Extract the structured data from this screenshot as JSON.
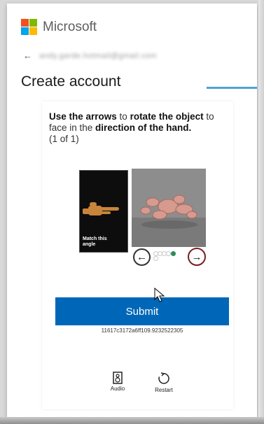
{
  "header": {
    "brand": "Microsoft",
    "back_arrow": "←",
    "email": "andy.garde.hotmail@gmail.com",
    "title": "Create account"
  },
  "challenge": {
    "instruction_prefix": "Use the arrows",
    "instruction_mid1": " to ",
    "instruction_rotate": "rotate the object",
    "instruction_mid2": " to face in the ",
    "instruction_direction": "direction of the hand.",
    "instruction_count": "(1 of 1)",
    "reference_label": "Match this angle",
    "left_arrow": "←",
    "right_arrow": "→",
    "submit_label": "Submit",
    "token": "11617c3172a6ff109.9232522305",
    "audio_label": "Audio",
    "restart_label": "Restart"
  },
  "colors": {
    "accent": "#0067b8",
    "progress": "#4fa1d8",
    "active_dot": "#2e8b57",
    "ms_red": "#f25022",
    "ms_green": "#7fba00",
    "ms_blue": "#00a4ef",
    "ms_yellow": "#ffb900"
  },
  "icons": [
    "microsoft-logo-icon",
    "back-arrow-icon",
    "left-arrow-icon",
    "right-arrow-icon",
    "audio-icon",
    "restart-icon"
  ]
}
